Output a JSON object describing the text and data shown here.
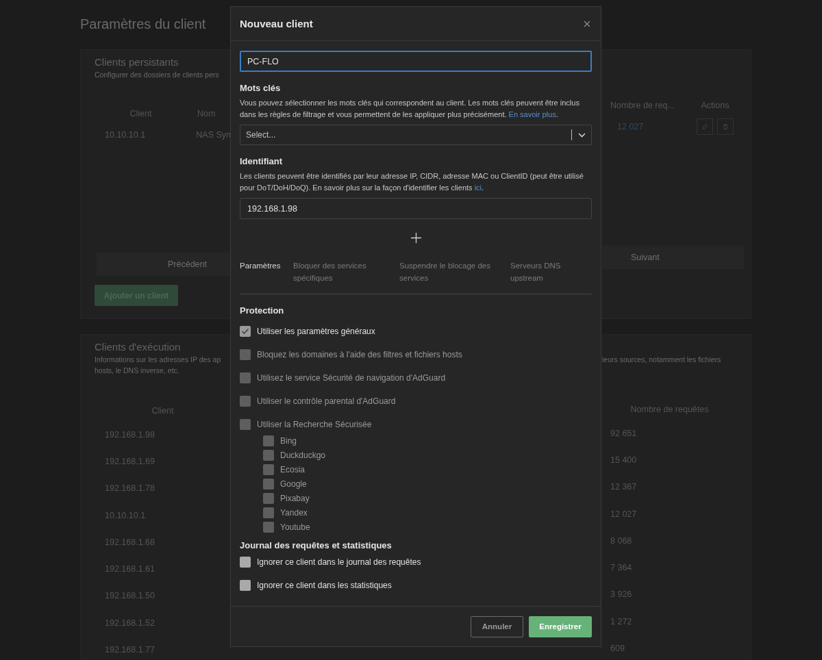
{
  "page": {
    "title": "Paramètres du client"
  },
  "persistent_clients": {
    "title": "Clients persistants",
    "description": "Configurer des dossiers de clients pers",
    "columns_left": [
      "Client",
      "Nom"
    ],
    "columns_right": [
      "Nombre de req...",
      "Actions"
    ],
    "rows": [
      {
        "client": "10.10.10.1",
        "name": "NAS Syn",
        "requests": "12 027"
      }
    ],
    "previous": "Précédent",
    "next": "Suivant",
    "add_button": "Ajouter un client"
  },
  "runtime_clients": {
    "title": "Clients d'exécution",
    "description_left": [
      "Informations sur les adresses IP des ap",
      "hosts, le DNS inverse, etc."
    ],
    "description_right": "ieurs sources, notamment les fichiers",
    "columns": [
      "Client",
      "Nombre de requêtes"
    ],
    "rows": [
      {
        "client": "192.168.1.98",
        "requests": "92 651"
      },
      {
        "client": "192.168.1.69",
        "requests": "15 400"
      },
      {
        "client": "192.168.1.78",
        "requests": "12 367"
      },
      {
        "client": "10.10.10.1",
        "requests": "12 027"
      },
      {
        "client": "192.168.1.68",
        "requests": "8 068"
      },
      {
        "client": "192.168.1.61",
        "requests": "7 364"
      },
      {
        "client": "192.168.1.50",
        "requests": "3 926"
      },
      {
        "client": "192.168.1.52",
        "requests": "1 272"
      },
      {
        "client": "192.168.1.77",
        "requests": "609"
      }
    ]
  },
  "modal": {
    "title": "Nouveau client",
    "name_value": "PC-FLO",
    "tags": {
      "title": "Mots clés",
      "description": "Vous pouvez sélectionner les mots clés qui correspondent au client. Les mots clés peuvent être inclus dans les règles de filtrage et vous permettent de les appliquer plus précisément. ",
      "link": "En savoir plus",
      "suffix": ".",
      "placeholder": "Select..."
    },
    "identifier": {
      "title": "Identifiant",
      "description": "Les clients peuvent être identifiés par leur adresse IP, CIDR, adresse MAC ou ClientID (peut être utilisé pour DoT/DoH/DoQ). En savoir plus sur la façon d'identifier les clients ",
      "link": "ici",
      "suffix": ".",
      "value": "192.168.1.98"
    },
    "tabs": [
      {
        "label": "Paramètres",
        "selected": true
      },
      {
        "label": "Bloquer des services spécifiques",
        "selected": false
      },
      {
        "label": "Suspendre le blocage des services",
        "selected": false
      },
      {
        "label": "Serveurs DNS upstream",
        "selected": false
      }
    ],
    "protection": {
      "title": "Protection",
      "items": [
        {
          "label": "Utiliser les paramètres généraux",
          "checked": true,
          "disabled": false
        },
        {
          "label": "Bloquez les domaines à l'aide des filtres et fichiers hosts",
          "checked": false,
          "disabled": true
        },
        {
          "label": "Utilisez le service Sécurité de navigation d'AdGuard",
          "checked": false,
          "disabled": true
        },
        {
          "label": "Utiliser le contrôle parental d'AdGuard",
          "checked": false,
          "disabled": true
        },
        {
          "label": "Utiliser la Recherche Sécurisée",
          "checked": false,
          "disabled": true,
          "children": [
            {
              "label": "Bing",
              "checked": false,
              "disabled": true
            },
            {
              "label": "Duckduckgo",
              "checked": false,
              "disabled": true
            },
            {
              "label": "Ecosia",
              "checked": false,
              "disabled": true
            },
            {
              "label": "Google",
              "checked": false,
              "disabled": true
            },
            {
              "label": "Pixabay",
              "checked": false,
              "disabled": true
            },
            {
              "label": "Yandex",
              "checked": false,
              "disabled": true
            },
            {
              "label": "Youtube",
              "checked": false,
              "disabled": true
            }
          ]
        }
      ]
    },
    "logging": {
      "title": "Journal des requêtes et statistiques",
      "items": [
        {
          "label": "Ignorer ce client dans le journal des requêtes",
          "checked": false,
          "disabled": false
        },
        {
          "label": "Ignorer ce client dans les statistiques",
          "checked": false,
          "disabled": false
        }
      ]
    },
    "cancel": "Annuler",
    "save": "Enregistrer"
  }
}
